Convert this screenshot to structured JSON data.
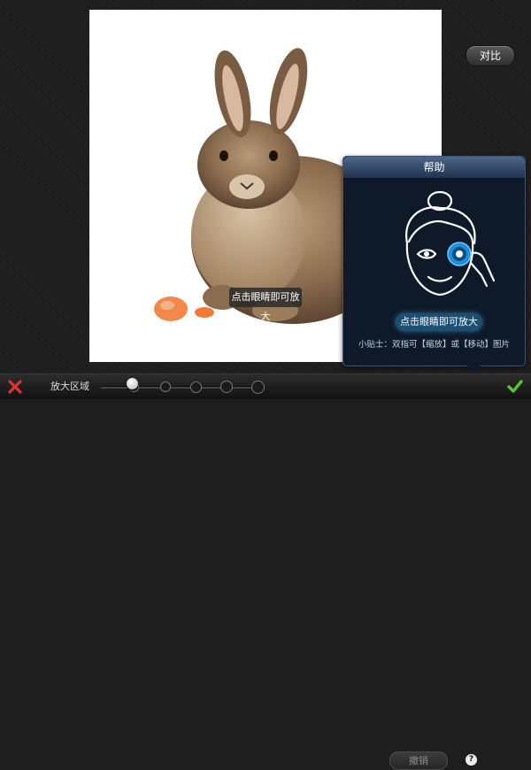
{
  "canvas": {
    "compare_label": "对比",
    "photo_tip_label": "点击眼睛即可放大"
  },
  "help_popover": {
    "title": "帮助",
    "action_label": "点击眼睛即可放大",
    "note": "小贴士：双指可【缩放】或【移动】图片"
  },
  "toolbar": {
    "cancel_icon": "close-icon",
    "zoom_area_label": "放大区域",
    "zoom_slider": {
      "stops": 5,
      "selected_stop": 1
    },
    "undo_label": "撤销",
    "help_label": "?",
    "confirm_icon": "checkmark-icon"
  },
  "colors": {
    "cancel": "#e0342c",
    "confirm": "#59c335",
    "popover_title": "#4c6587",
    "eye_highlight": "#1e90d8"
  }
}
